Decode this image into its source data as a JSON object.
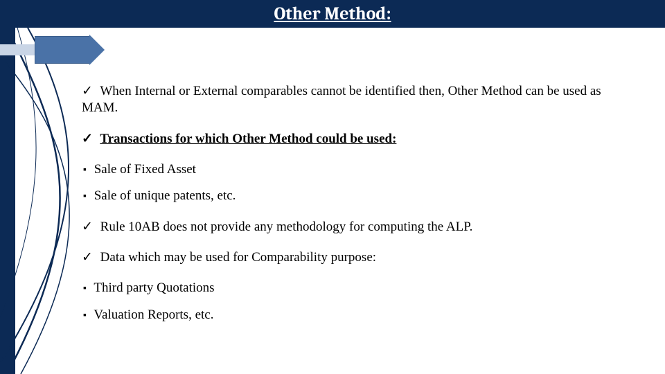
{
  "title": "Other Method:",
  "bullets": {
    "b1": "When Internal or External comparables cannot be identified then, Other Method can be used as MAM.",
    "b2": "Transactions for which Other Method could be used:",
    "b3": "Sale of Fixed Asset",
    "b4": "Sale of unique patents, etc.",
    "b5": "Rule 10AB does not provide any methodology for computing the ALP.",
    "b6": "Data which may be used for Comparability purpose:",
    "b7": "Third party Quotations",
    "b8": "Valuation Reports, etc."
  }
}
